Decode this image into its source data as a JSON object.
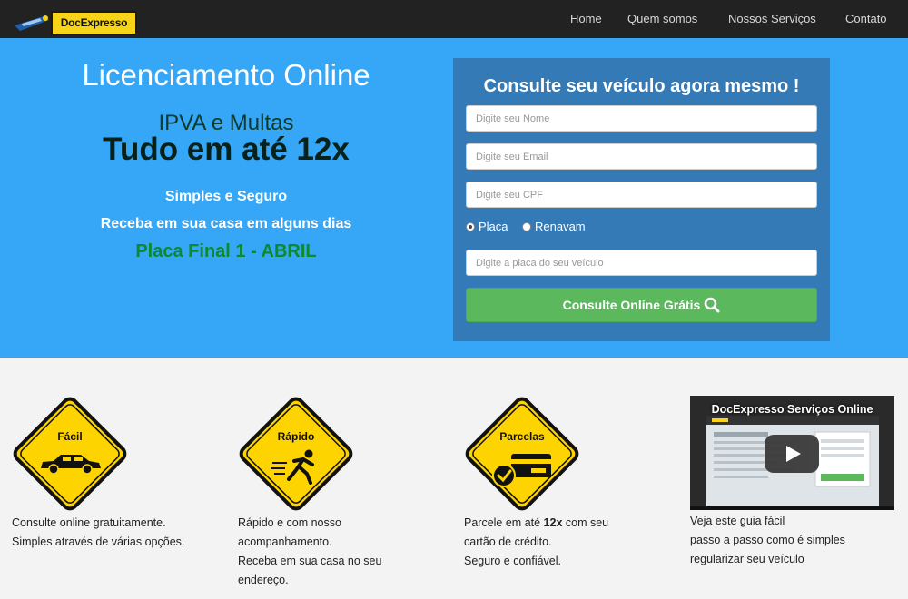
{
  "navbar": {
    "brand": "DocExpresso",
    "links": [
      "Home",
      "Quem somos",
      "Nossos Serviços",
      "Contato"
    ]
  },
  "hero": {
    "title": "Licenciamento Online",
    "subtitle1": "IPVA e Multas",
    "subtitle2": "Tudo em até 12x",
    "line1": "Simples e Seguro",
    "line2": "Receba em sua casa em alguns dias",
    "line3": "Placa Final 1 - ABRIL"
  },
  "form": {
    "title": "Consulte seu veículo agora mesmo !",
    "name_placeholder": "Digite seu Nome",
    "email_placeholder": "Digite seu Email",
    "cpf_placeholder": "Digite seu CPF",
    "radio_placa": "Placa",
    "radio_renavam": "Renavam",
    "selected": "Placa",
    "plate_placeholder": "Digite a placa do seu veículo",
    "submit_label": "Consulte Online Grátis"
  },
  "features": [
    {
      "sign": "Fácil",
      "icon": "car-icon",
      "lines": [
        "Consulte online gratuitamente.",
        "Simples através de várias opções."
      ]
    },
    {
      "sign": "Rápido",
      "icon": "running-person-icon",
      "lines": [
        "Rápido e com nosso",
        "acompanhamento.",
        "Receba em sua casa no seu",
        "endereço."
      ]
    },
    {
      "sign": "Parcelas",
      "icon": "credit-card-check-icon",
      "text_before": "Parcele em até ",
      "text_bold": "12x",
      "text_after": " com seu",
      "lines": [
        "cartão de crédito.",
        "Seguro e confiável."
      ]
    }
  ],
  "video": {
    "title": "DocExpresso Serviços Online",
    "lines": [
      "Veja este guia fácil",
      "passo a passo como é simples",
      "regularizar seu veículo"
    ]
  },
  "colors": {
    "navbar": "#222222",
    "hero": "#36a6f7",
    "form_panel": "#337ab7",
    "button": "#5cb85c",
    "sign_yellow": "#fdd300",
    "highlight_green": "#0d8a2c"
  }
}
